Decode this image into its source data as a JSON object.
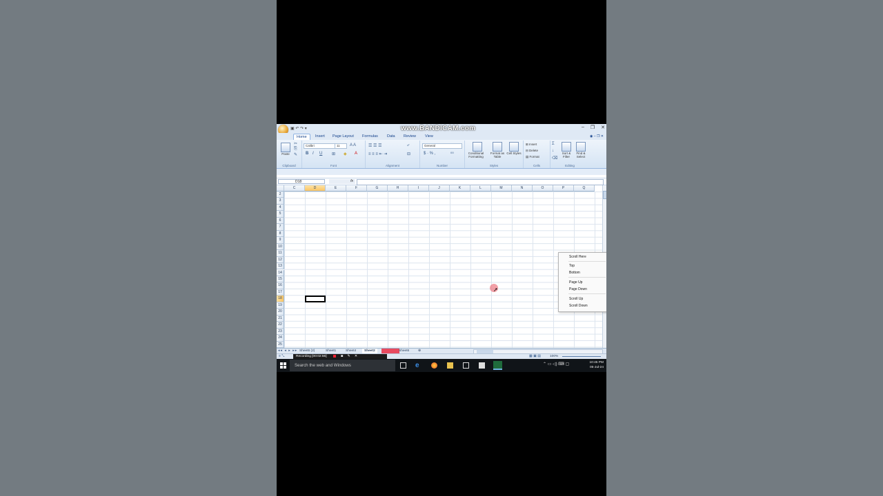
{
  "watermark": "www.BANDICAM.com",
  "window_controls": [
    "–",
    "❐",
    "✕"
  ],
  "ribbon_tabs": [
    "Home",
    "Insert",
    "Page Layout",
    "Formulas",
    "Data",
    "Review",
    "View"
  ],
  "ribbon": {
    "clipboard": {
      "paste": "Paste",
      "label": "Clipboard"
    },
    "font": {
      "name": "Calibri",
      "size": "11",
      "label": "Font"
    },
    "alignment": {
      "label": "Alignment"
    },
    "number": {
      "format": "General",
      "label": "Number"
    },
    "styles": {
      "conditional": "Conditional Formatting",
      "format_table": "Format as Table",
      "cell_styles": "Cell Styles",
      "label": "Styles"
    },
    "cells": {
      "insert": "Insert",
      "delete": "Delete",
      "format": "Format",
      "label": "Cells"
    },
    "editing": {
      "sort": "Sort & Filter",
      "find": "Find & Select",
      "label": "Editing"
    }
  },
  "name_box": "D18",
  "fx": "fx",
  "columns": [
    "C",
    "D",
    "E",
    "F",
    "G",
    "H",
    "I",
    "J",
    "K",
    "L",
    "M",
    "N",
    "O",
    "P",
    "Q"
  ],
  "selected_column": "D",
  "rows": [
    "2",
    "3",
    "4",
    "5",
    "6",
    "7",
    "8",
    "9",
    "10",
    "11",
    "12",
    "13",
    "14",
    "15",
    "16",
    "17",
    "18",
    "19",
    "20",
    "21",
    "22",
    "23",
    "24",
    "25"
  ],
  "selected_row": "18",
  "context_menu": [
    "Scroll Here",
    "Top",
    "Bottom",
    "Page Up",
    "Page Down",
    "Scroll Up",
    "Scroll Down"
  ],
  "sheet_tabs": [
    "Sheet6 (2)",
    "Sheet1",
    "Sheet4",
    "Sheet2",
    "Sheet6"
  ],
  "active_sheet": "Sheet2",
  "recording": "Recording [00:02:56]",
  "zoom": "100%",
  "taskbar": {
    "search_placeholder": "Search the web and Windows",
    "time": "10:45 PM",
    "date": "05-Jul-24"
  },
  "colors": {
    "accent": "#15428b",
    "selected_header": "#f9c463",
    "highlight": "#e84a5f"
  }
}
